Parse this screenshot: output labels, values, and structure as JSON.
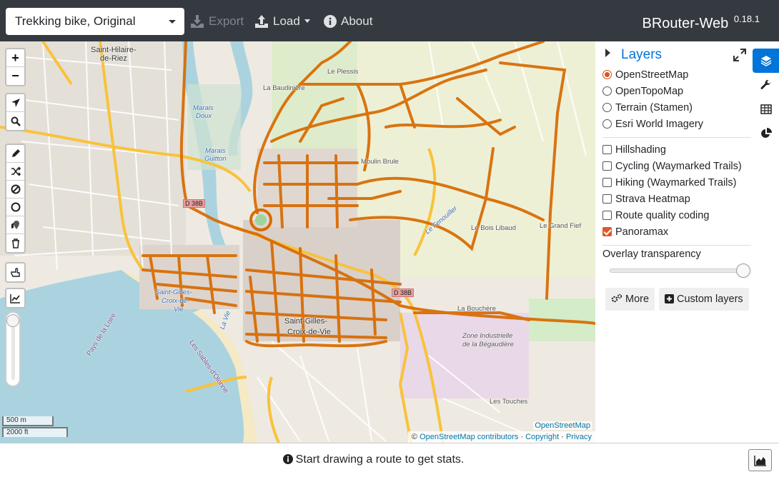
{
  "navbar": {
    "profile": "Trekking bike, Original",
    "export_label": "Export",
    "load_label": "Load",
    "about_label": "About",
    "brand": "BRouter-Web",
    "version": "0.18.1"
  },
  "map": {
    "labels": {
      "saint_hilaire": "Saint-Hilaire-",
      "de_riez": "de-Riez",
      "le_plessis": "Le Plessis",
      "la_bauduiniere": "La Baudinière",
      "marais_doux_1": "Marais",
      "marais_doux_2": "Doux",
      "marais_guitton_1": "Marais",
      "marais_guitton_2": "Guitton",
      "moulin_brule": "Moulin Brule",
      "d38": "D 38B",
      "d38b": "D 38B",
      "le_fenouiller": "Le Fenouiller",
      "le_bois_libaud": "Le Bois Libaud",
      "le_grand_fief": "Le Grand Fief",
      "saint_gilles_1": "Saint-Gilles-",
      "saint_gilles_2": "Croix-de-",
      "saint_gilles_3": "Vie",
      "saint_gilles_center_1": "Saint-Gilles-",
      "saint_gilles_center_2": "Croix-de-Vie",
      "la_bouchere": "La Bouchère",
      "zone_1": "Zone Industrielle",
      "zone_2": "de la Bégaudière",
      "les_touches": "Les Touches",
      "pays_de_la_loire": "Pays de la Loire",
      "les_sables": "Les Sables-d'Olonne",
      "la_vie": "La Vie"
    },
    "scale_m": "500 m",
    "scale_ft": "2000 ft",
    "osm_tag": "OpenStreetMap",
    "attribution_prefix": "©",
    "attribution_osm": "OpenStreetMap contributors",
    "attribution_copyright": "Copyright",
    "attribution_privacy": "Privacy",
    "attribution_sep": "·",
    "controls": {
      "zoom_in": "+",
      "zoom_out": "−"
    }
  },
  "sidebar": {
    "title": "Layers",
    "base_layers": [
      {
        "label": "OpenStreetMap",
        "selected": true
      },
      {
        "label": "OpenTopoMap",
        "selected": false
      },
      {
        "label": "Terrain (Stamen)",
        "selected": false
      },
      {
        "label": "Esri World Imagery",
        "selected": false
      }
    ],
    "overlays": [
      {
        "label": "Hillshading",
        "checked": false
      },
      {
        "label": "Cycling (Waymarked Trails)",
        "checked": false
      },
      {
        "label": "Hiking (Waymarked Trails)",
        "checked": false
      },
      {
        "label": "Strava Heatmap",
        "checked": false
      },
      {
        "label": "Route quality coding",
        "checked": false
      },
      {
        "label": "Panoramax",
        "checked": true
      }
    ],
    "overlay_transparency_label": "Overlay transparency",
    "overlay_transparency_value": 0.95,
    "more_button": "More",
    "custom_layers_button": "Custom layers",
    "accent_color": "#0074d9"
  },
  "bottombar": {
    "stats_message": "Start drawing a route to get stats."
  }
}
